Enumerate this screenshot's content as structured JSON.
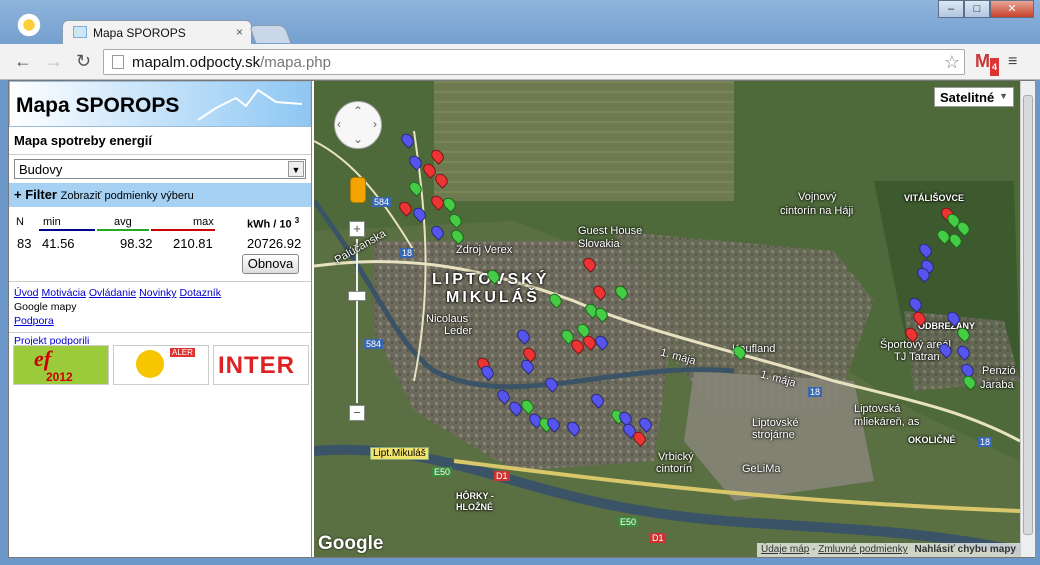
{
  "browser": {
    "tab_title": "Mapa SPOROPS",
    "tab_close": "×",
    "url_host": "mapalm.odpocty.sk",
    "url_path": "/mapa.php",
    "gmail_count": "4",
    "win_min": "–",
    "win_max": "□",
    "win_close": "✕"
  },
  "sidebar": {
    "brand": "Mapa SPOROPS",
    "section_title": "Mapa spotreby energií",
    "select_value": "Budovy",
    "filter_label": "+ Filter",
    "filter_hint": "Zobraziť podmienky výberu",
    "stats": {
      "h_n": "N",
      "h_min": "min",
      "h_avg": "avg",
      "h_max": "max",
      "h_unit": "kWh / 10",
      "h_exp": "3",
      "n": "83",
      "min": "41.56",
      "avg": "98.32",
      "max": "210.81",
      "sum": "20726.92"
    },
    "refresh_label": "Obnova",
    "links": [
      "Úvod",
      "Motivácia",
      "Ovládanie",
      "Novinky",
      "Dotazník"
    ],
    "google_maps": "Google mapy",
    "support": "Podpora",
    "project_link": "Projekt podporili",
    "logo_year": "2012",
    "logo_aler": "ALER",
    "logo_inter": "INTER"
  },
  "map": {
    "type_label": "Satelitné",
    "google": "Google",
    "attr_data": "Údaje máp",
    "attr_terms": "Zmluvné podmienky",
    "attr_report": "Nahlásiť chybu mapy",
    "labels": {
      "city": "LIPTOVSKÝ",
      "city2": "MIKULÁŠ",
      "guest": "Guest House",
      "slovakia": "Slovakia",
      "zdroj": "Zdroj Verex",
      "palucanska": "Palúčanska",
      "nicolaus": "Nicolaus",
      "leder": "Leder",
      "vojnovy": "Vojnový",
      "cintorin_haji": "cintorín na Háji",
      "vitalisovce": "VITÁLIŠOVCE",
      "odbrezany": "ODBREZANY",
      "sportovy": "Športový areál",
      "tatran": "TJ Tatran",
      "penzion": "Penzió",
      "jaraba": "Jaraba",
      "maja1": "1. mája",
      "maja2": "1. mája",
      "kaufland": "Kaufland",
      "liptovske": "Liptovské",
      "strojarne": "strojárne",
      "mliekaren": "Liptovská",
      "mliekaren2": "mliekáreň, as",
      "okolicne": "OKOLIČNÉ",
      "vrbicky": "Vrbický",
      "vrbicky2": "cintorín",
      "gelima": "GeLiMa",
      "horky": "HÔRKY -",
      "hlozne": "HLOŽNÉ",
      "lipt": "Lipt.Mikuláš",
      "e50": "E50",
      "d1": "D1",
      "e50b": "E50",
      "d1b": "D1",
      "r584": "584",
      "r584b": "584",
      "r18": "18",
      "r18b": "18",
      "r18c": "18"
    }
  }
}
